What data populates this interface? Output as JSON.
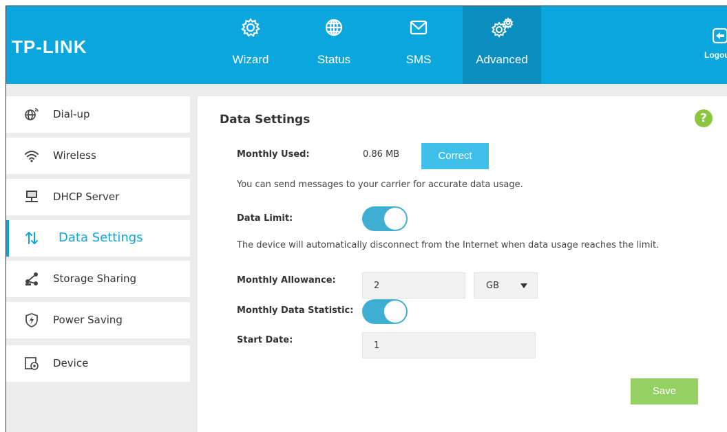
{
  "header": {
    "logo": "TP-LINK",
    "nav": [
      {
        "label": "Wizard",
        "icon": "gear-icon"
      },
      {
        "label": "Status",
        "icon": "globe-icon"
      },
      {
        "label": "SMS",
        "icon": "envelope-icon"
      },
      {
        "label": "Advanced",
        "icon": "gears-icon",
        "active": true
      }
    ],
    "logout_label": "Logout"
  },
  "sidebar": {
    "items": [
      {
        "label": "Dial-up",
        "icon": "globe-signal-icon"
      },
      {
        "label": "Wireless",
        "icon": "wifi-icon"
      },
      {
        "label": "DHCP Server",
        "icon": "monitor-network-icon"
      },
      {
        "label": "Data Settings",
        "icon": "up-down-arrows-icon",
        "active": true
      },
      {
        "label": "Storage Sharing",
        "icon": "share-icon"
      },
      {
        "label": "Power Saving",
        "icon": "power-shield-icon"
      },
      {
        "label": "Device",
        "icon": "device-gear-icon"
      }
    ]
  },
  "main": {
    "title": "Data Settings",
    "help_label": "?",
    "monthly_used_label": "Monthly Used:",
    "monthly_used_value": "0.86 MB",
    "correct_button": "Correct",
    "correct_note": "You can send messages to your carrier for accurate data usage.",
    "data_limit_label": "Data Limit:",
    "data_limit_on": true,
    "data_limit_note": "The device will automatically disconnect from the Internet when data usage reaches the limit.",
    "monthly_allowance_label": "Monthly Allowance:",
    "monthly_allowance_value": "2",
    "allowance_unit": "GB",
    "monthly_statistic_label": "Monthly Data Statistic:",
    "monthly_statistic_on": true,
    "start_date_label": "Start Date:",
    "start_date_value": "1",
    "save_button": "Save"
  },
  "colors": {
    "brand": "#0aa6de",
    "nav_active": "#0a8ec0",
    "toggle_on": "#3eaed3",
    "save": "#95d062",
    "help": "#8cc63f"
  }
}
